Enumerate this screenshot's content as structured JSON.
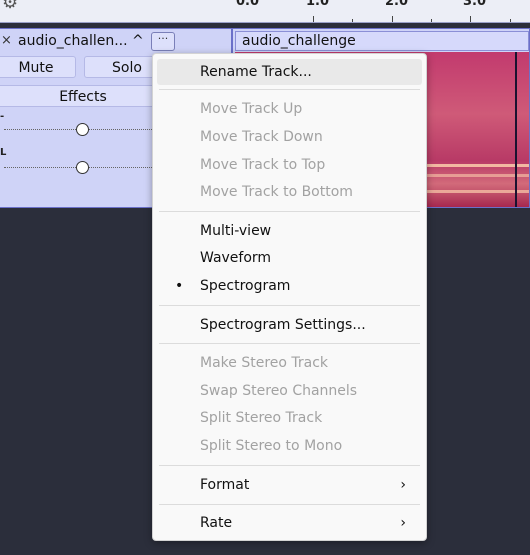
{
  "ruler": {
    "ticks": [
      "0.0",
      "1.0",
      "2.0",
      "3.0"
    ]
  },
  "track": {
    "name": "audio_challen...",
    "collapse_glyph": "^",
    "menu_glyph": "···",
    "close_glyph": "×",
    "mute_label": "Mute",
    "solo_label": "Solo",
    "effects_label": "Effects",
    "gain_slider_label": "-",
    "pan_slider_label": "L",
    "gain_value_fraction": 0.5,
    "pan_value_fraction": 0.5
  },
  "clip": {
    "title": "audio_challenge"
  },
  "menu": {
    "items": [
      {
        "label": "Rename Track...",
        "enabled": true,
        "hover": true
      },
      {
        "label": "Move Track Up",
        "enabled": false
      },
      {
        "label": "Move Track Down",
        "enabled": false
      },
      {
        "label": "Move Track to Top",
        "enabled": false
      },
      {
        "label": "Move Track to Bottom",
        "enabled": false
      },
      {
        "label": "Multi-view",
        "enabled": true
      },
      {
        "label": "Waveform",
        "enabled": true
      },
      {
        "label": "Spectrogram",
        "enabled": true,
        "checked": true
      },
      {
        "label": "Spectrogram Settings...",
        "enabled": true
      },
      {
        "label": "Make Stereo Track",
        "enabled": false
      },
      {
        "label": "Swap Stereo Channels",
        "enabled": false
      },
      {
        "label": "Split Stereo Track",
        "enabled": false
      },
      {
        "label": "Split Stereo to Mono",
        "enabled": false
      },
      {
        "label": "Format",
        "enabled": true,
        "submenu": true
      },
      {
        "label": "Rate",
        "enabled": true,
        "submenu": true
      }
    ],
    "bullet_glyph": "•",
    "submenu_glyph": "›"
  },
  "icons": {
    "settings": "gear-icon"
  }
}
